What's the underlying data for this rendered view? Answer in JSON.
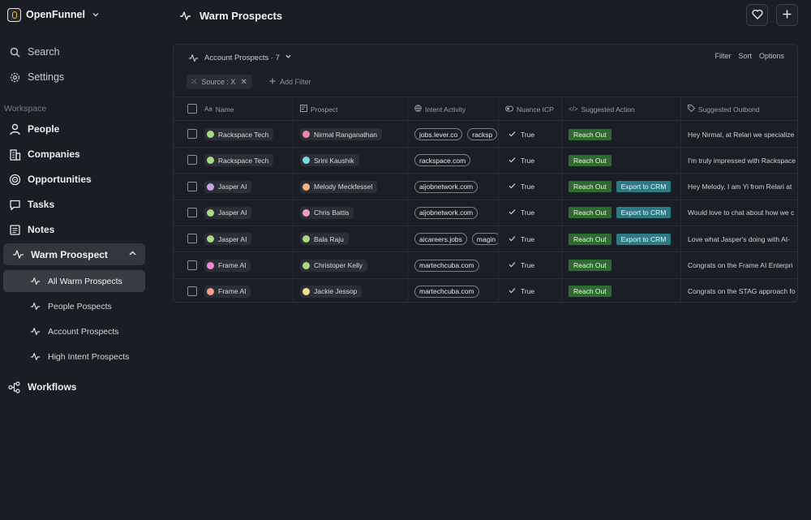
{
  "workspace": {
    "name": "OpenFunnel"
  },
  "sidebar": {
    "search_label": "Search",
    "settings_label": "Settings",
    "section_label": "Workspace",
    "items": [
      {
        "label": "People"
      },
      {
        "label": "Companies"
      },
      {
        "label": "Opportunities"
      },
      {
        "label": "Tasks"
      },
      {
        "label": "Notes"
      }
    ],
    "warm_group": {
      "label": "Warm Proospect",
      "subitems": [
        {
          "label": "All Warm Prospects"
        },
        {
          "label": "People Pospects"
        },
        {
          "label": "Account Prospects"
        },
        {
          "label": "High Intent Prospects"
        }
      ]
    },
    "workflows_label": "Workflows"
  },
  "header": {
    "title": "Warm Prospects"
  },
  "view": {
    "name": "Account Prospects · 7",
    "actions": {
      "filter": "Filter",
      "sort": "Sort",
      "options": "Options"
    },
    "filter_chip": "Source : X",
    "add_filter": "Add Filter"
  },
  "table": {
    "columns": {
      "name": "Name",
      "prospect": "Prospect",
      "intent": "Intent Activity",
      "icp": "Nuance ICP",
      "action": "Suggested Action",
      "outbound": "Suggested Outbond"
    },
    "rows": [
      {
        "name": "Rackspace Tech",
        "name_color": "#a6d98a",
        "prospect": "Nirmal Ranganathan",
        "prospect_color": "#f08a9e",
        "intent": [
          "jobs.lever.co",
          "racksp"
        ],
        "icp": "True",
        "actions": [
          "Reach Out"
        ],
        "outbound": "Hey Nirmal, at Relari we specialize"
      },
      {
        "name": "Rackspace Tech",
        "name_color": "#a6d98a",
        "prospect": "Srini Kaushik",
        "prospect_color": "#7fd6e0",
        "intent": [
          "rackspace.com"
        ],
        "icp": "True",
        "actions": [
          "Reach Out"
        ],
        "outbound": "I'm truly impressed with Rackspace"
      },
      {
        "name": "Jasper AI",
        "name_color": "#c4a6e8",
        "prospect": "Melody Meckfessel",
        "prospect_color": "#f2b48a",
        "intent": [
          "aijobnetwork.com"
        ],
        "icp": "True",
        "actions": [
          "Reach Out",
          "Export to CRM"
        ],
        "outbound": "Hey Melody, I am Yi from Relari at"
      },
      {
        "name": "Jasper AI",
        "name_color": "#a6d98a",
        "prospect": "Chris Battis",
        "prospect_color": "#f0a0c8",
        "intent": [
          "aijobnetwork.com"
        ],
        "icp": "True",
        "actions": [
          "Reach Out",
          "Export to CRM"
        ],
        "outbound": "Would love to chat about how we c"
      },
      {
        "name": "Jasper AI",
        "name_color": "#a6d98a",
        "prospect": "Bala Raju",
        "prospect_color": "#a6d98a",
        "intent": [
          "aicareers.jobs",
          "magin"
        ],
        "icp": "True",
        "actions": [
          "Reach Out",
          "Export to CRM"
        ],
        "outbound": "Love what Jasper's doing with AI-"
      },
      {
        "name": "Frame AI",
        "name_color": "#f08ad0",
        "prospect": "Christoper Kelly",
        "prospect_color": "#a6d98a",
        "intent": [
          "martechcuba.com"
        ],
        "icp": "True",
        "actions": [
          "Reach Out"
        ],
        "outbound": "Congrats on the Frame AI Enterpri"
      },
      {
        "name": "Frame AI",
        "name_color": "#f2a08a",
        "prospect": "Jackie Jessop",
        "prospect_color": "#f0e08a",
        "intent": [
          "martechcuba.com"
        ],
        "icp": "True",
        "actions": [
          "Reach Out"
        ],
        "outbound": "Congrats on the STAG approach fo"
      }
    ]
  }
}
